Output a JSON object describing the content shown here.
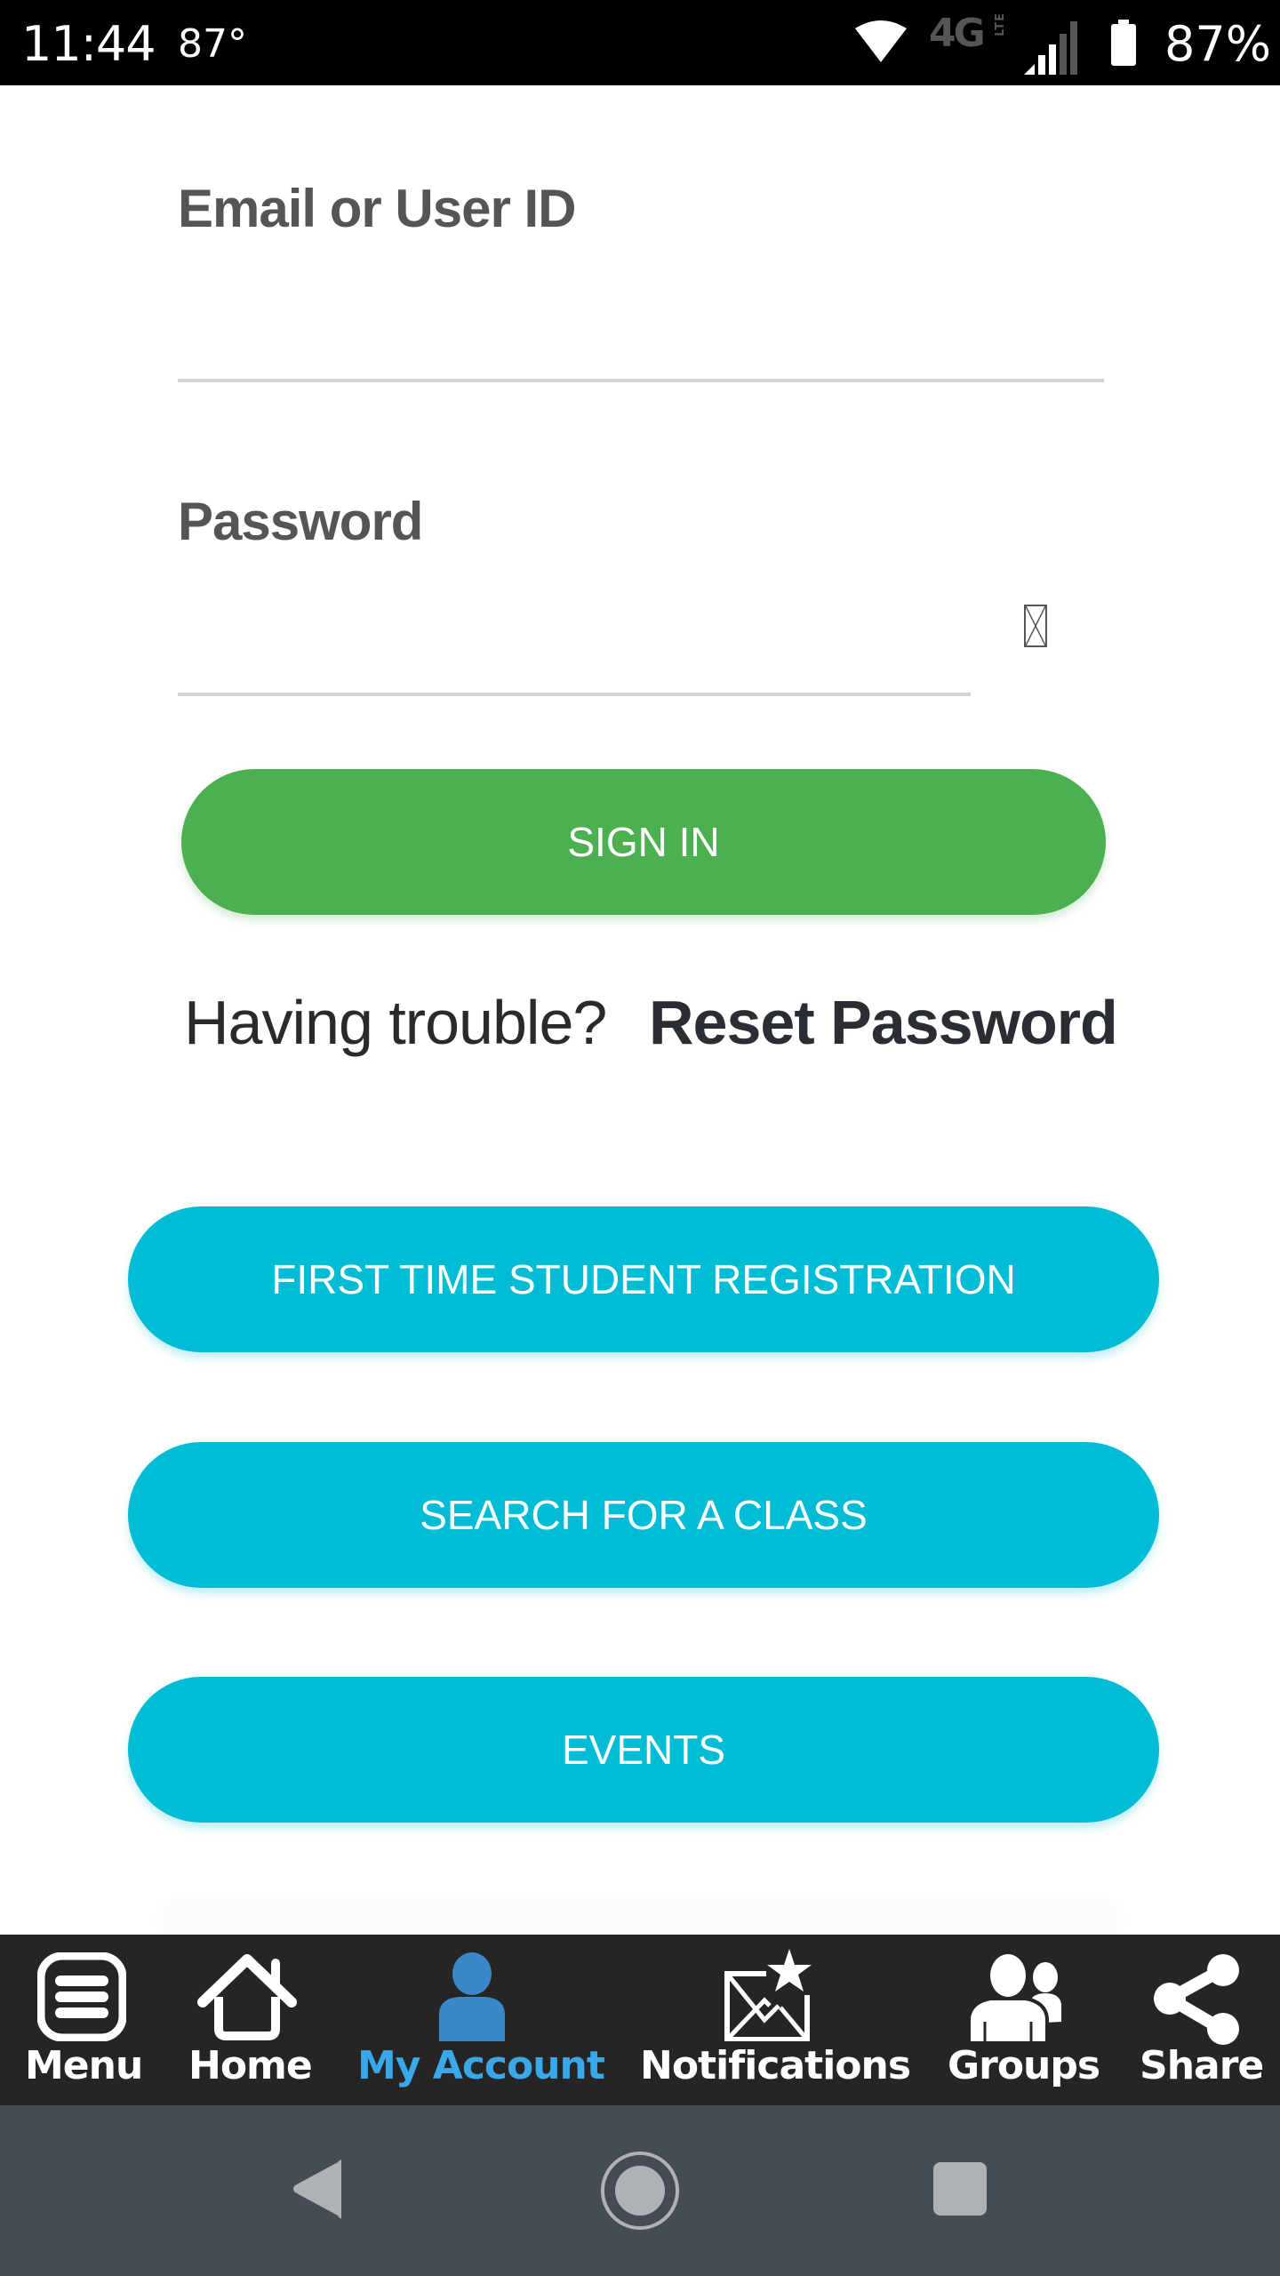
{
  "status_bar": {
    "time": "11:44",
    "temperature": "87°",
    "network": "4G",
    "network_sub": "LTE",
    "battery_percent": "87%",
    "icons": [
      "wifi-icon",
      "lte-icon",
      "signal-icon",
      "battery-icon"
    ]
  },
  "login_form": {
    "email_label": "Email or User ID",
    "email_value": "",
    "email_placeholder": "",
    "password_label": "Password",
    "password_value": "",
    "password_placeholder": "",
    "password_toggle_glyph": "",
    "sign_in_label": "SIGN IN",
    "trouble_text": "Having trouble?",
    "reset_password_label": "Reset Password"
  },
  "actions": {
    "register_label": "FIRST TIME STUDENT REGISTRATION",
    "search_class_label": "SEARCH FOR A CLASS",
    "events_label": "EVENTS"
  },
  "bottom_nav": {
    "items": [
      {
        "label": "Menu",
        "icon": "menu-icon",
        "active": false
      },
      {
        "label": "Home",
        "icon": "home-icon",
        "active": false
      },
      {
        "label": "My Account",
        "icon": "account-icon",
        "active": true
      },
      {
        "label": "Notifications",
        "icon": "notifications-icon",
        "active": false
      },
      {
        "label": "Groups",
        "icon": "groups-icon",
        "active": false
      },
      {
        "label": "Share",
        "icon": "share-icon",
        "active": false
      }
    ]
  },
  "system_nav": {
    "buttons": [
      "back",
      "home",
      "recents"
    ]
  },
  "colors": {
    "sign_in": "#4caf50",
    "action_buttons": "#00bcd4",
    "active_nav": "#3aa8e8",
    "nav_background": "#252525",
    "system_nav_background": "#454c53"
  }
}
